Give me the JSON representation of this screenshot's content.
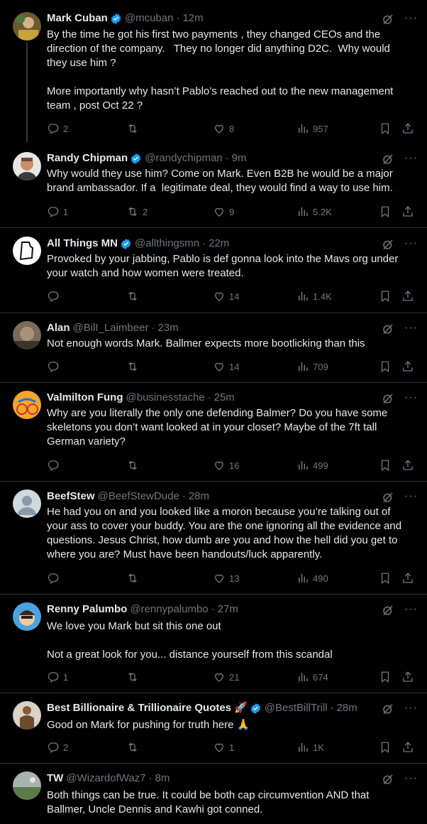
{
  "tweets": [
    {
      "name": "Mark Cuban",
      "handle": "@mcuban",
      "time": "12m",
      "verified": true,
      "emoji": "",
      "text": "By the time he got his first two payments , they changed CEOs and the\ndirection of the company.   They no longer did anything D2C.  Why would\nthey use him ?\n\nMore importantly why hasn’t Pablo’s reached out to the new management\nteam , post Oct 22 ?",
      "replies": "2",
      "retweets": "",
      "likes": "8",
      "views": "957"
    },
    {
      "name": "Randy Chipman",
      "handle": "@randychipman",
      "time": "9m",
      "verified": true,
      "emoji": "",
      "text": "Why would they use him? Come on Mark. Even B2B he would be a major\nbrand ambassador. If a  legitimate deal, they would find a way to use him.",
      "replies": "1",
      "retweets": "2",
      "likes": "9",
      "views": "5.2K"
    },
    {
      "name": "All Things MN",
      "handle": "@allthingsmn",
      "time": "22m",
      "verified": true,
      "emoji": "",
      "text": "Provoked by your jabbing, Pablo is def gonna look into the Mavs org under\nyour watch and how women were treated.",
      "replies": "",
      "retweets": "",
      "likes": "14",
      "views": "1.4K"
    },
    {
      "name": "Alan",
      "handle": "@BilI_Laimbeer",
      "time": "23m",
      "verified": false,
      "emoji": "",
      "text": "Not enough words Mark. Ballmer expects more bootlicking than this",
      "replies": "",
      "retweets": "",
      "likes": "14",
      "views": "709"
    },
    {
      "name": "Valmilton Fung",
      "handle": "@businesstache",
      "time": "25m",
      "verified": false,
      "emoji": "",
      "text": "Why are you literally the only one defending Balmer? Do you have some\nskeletons you don’t want looked at in your closet? Maybe of the 7ft tall\nGerman variety?",
      "replies": "",
      "retweets": "",
      "likes": "16",
      "views": "499"
    },
    {
      "name": "BeefStew",
      "handle": "@BeefStewDude",
      "time": "28m",
      "verified": false,
      "emoji": "",
      "text": "He had you on and you looked like a moron because you’re talking out of\nyour ass to cover your buddy. You are the one ignoring all the evidence and\nquestions. Jesus Christ, how dumb are you and how the hell did you get to\nwhere you are? Must have been handouts/luck apparently.",
      "replies": "",
      "retweets": "",
      "likes": "13",
      "views": "490"
    },
    {
      "name": "Renny Palumbo",
      "handle": "@rennypalumbo",
      "time": "27m",
      "verified": false,
      "emoji": "",
      "text": "We love you Mark but sit this one out\n\nNot a great look for you... distance yourself from this scandal",
      "replies": "1",
      "retweets": "",
      "likes": "21",
      "views": "674"
    },
    {
      "name": "Best Billionaire & Trillionaire Quotes",
      "handle": "@BestBillTrill",
      "time": "28m",
      "verified": true,
      "emoji": "🚀",
      "text": "Good on Mark for pushing for truth here 🙏",
      "replies": "2",
      "retweets": "",
      "likes": "1",
      "views": "1K"
    },
    {
      "name": "TW",
      "handle": "@WizardofWaz7",
      "time": "8m",
      "verified": false,
      "emoji": "",
      "text": "Both things can be true. It could be both cap circumvention AND that\nBallmer, Uncle Dennis and Kawhi got conned.",
      "replies": "",
      "retweets": "",
      "likes": "",
      "views": ""
    }
  ],
  "icons": {
    "verified": "verified-badge-icon",
    "grok": "grok-icon",
    "more": "more-icon",
    "reply": "reply-icon",
    "retweet": "retweet-icon",
    "like": "like-icon",
    "views": "views-icon",
    "bookmark": "bookmark-icon",
    "share": "share-icon"
  },
  "colors": {
    "background": "#000000",
    "text": "#e7e9ea",
    "muted": "#71767b",
    "divider": "#2f3336",
    "verified": "#1d9bf0"
  }
}
